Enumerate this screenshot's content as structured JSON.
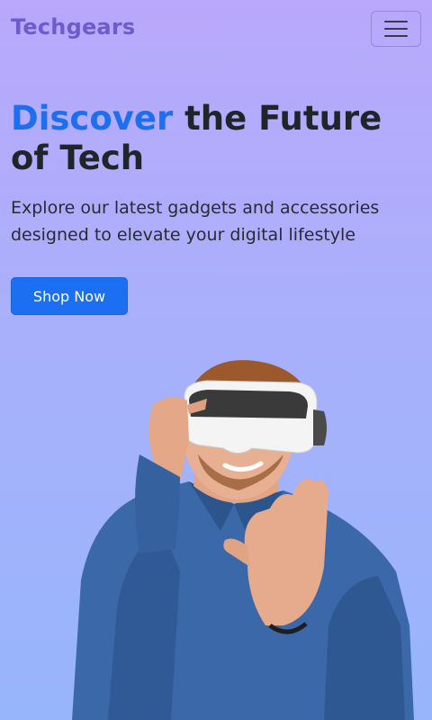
{
  "nav": {
    "brand": "Techgears",
    "menu_icon": "hamburger-menu-icon"
  },
  "hero": {
    "title_accent": "Discover",
    "title_rest": " the Future of Tech",
    "subtitle": "Explore our latest gadgets and accessories designed to elevate your digital lifestyle",
    "cta_label": "Shop Now",
    "image": "person-with-vr-headset-image"
  },
  "colors": {
    "brand": "#6f5bd0",
    "accent": "#1d6ff2",
    "button": "#1d6ff2",
    "shirt": "#3a68a8"
  }
}
